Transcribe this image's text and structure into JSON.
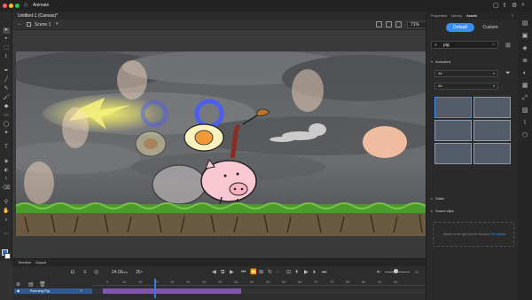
{
  "titlebar": {
    "app_name": "Animate",
    "home_glyph": "⌂",
    "window_controls": [
      {
        "name": "close",
        "color": "#ff5f57"
      },
      {
        "name": "minimize",
        "color": "#febc2e"
      },
      {
        "name": "maximize",
        "color": "#28c840"
      }
    ]
  },
  "document": {
    "tab_title": "Untitled-1 (Canvas)*",
    "scene_label": "Scene 1",
    "zoom": "71%"
  },
  "timeline": {
    "tabs": [
      "Timeline",
      "Output"
    ],
    "fps": "24.00",
    "fps_unit": "FPS",
    "current_frame": "25",
    "frame_suffix": "F",
    "ruler_numbers": [
      "5",
      "10",
      "15",
      "20",
      "25",
      "30",
      "35",
      "40",
      "45",
      "50",
      "55",
      "60",
      "65",
      "70",
      "75",
      "80",
      "85",
      "90",
      "95"
    ],
    "layer_name": "Running Pig"
  },
  "properties": {
    "tabs": [
      "Properties",
      "Library",
      "Assets"
    ],
    "active_tab": "Assets",
    "segments": [
      "Default",
      "Custom"
    ],
    "active_segment": "Default",
    "search_value": "pig",
    "section_animated": "Animated",
    "dropdown1": "All",
    "dropdown2": "All",
    "section_static": "Static",
    "section_sound": "Sound clips",
    "empty_text": "Assets of the type can be found in",
    "empty_link": "Get started"
  },
  "colors": {
    "accent": "#2e7de0",
    "layer_highlight": "#2f5a93",
    "tween_span": "#7e56b0",
    "stroke_swatch": "#1e6fd6",
    "fill_swatch": "#ffffff"
  }
}
